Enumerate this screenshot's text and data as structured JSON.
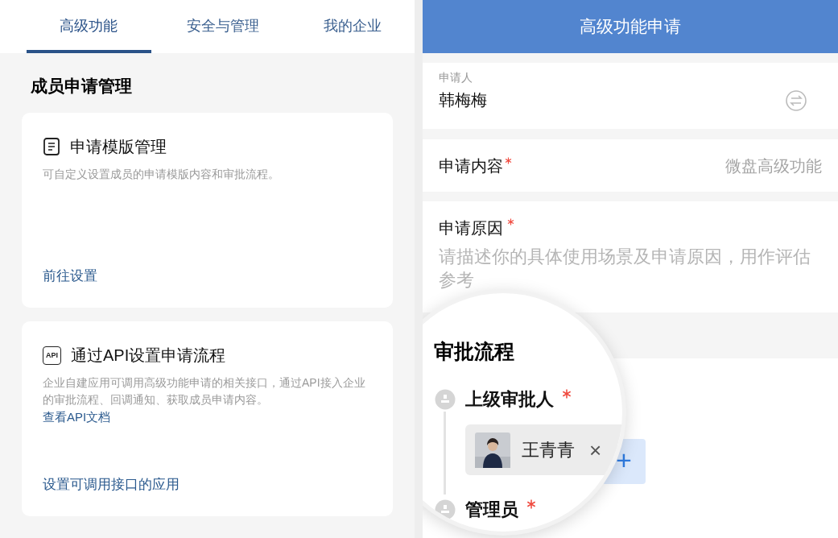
{
  "tabs": [
    {
      "label": "高级功能",
      "selected": true
    },
    {
      "label": "安全与管理",
      "selected": false
    },
    {
      "label": "我的企业",
      "selected": false
    }
  ],
  "section_title": "成员申请管理",
  "cards": [
    {
      "kind": "doc",
      "title": "申请模版管理",
      "description": "可自定义设置成员的申请模版内容和审批流程。",
      "action": "前往设置"
    },
    {
      "kind": "api",
      "icon_text": "API",
      "title": "通过API设置申请流程",
      "description": "企业自建应用可调用高级功能申请的相关接口，通过API接入企业的审批流程、回调通知、获取成员申请内容。",
      "link": "查看API文档",
      "action": "设置可调用接口的应用"
    }
  ],
  "form": {
    "title": "高级功能申请",
    "applicant": {
      "label": "申请人",
      "value": "韩梅梅"
    },
    "content": {
      "label": "申请内容",
      "required": true,
      "value": "微盘高级功能"
    },
    "reason": {
      "label": "申请原因",
      "required": true,
      "placeholder": "请描述你的具体使用场景及申请原因，用作评估参考"
    },
    "approval": {
      "title": "审批流程",
      "add_button": "+",
      "steps": [
        {
          "label": "上级审批人",
          "required": true,
          "approvers": [
            {
              "name": "王青青",
              "remove": "×"
            }
          ]
        },
        {
          "label": "管理员",
          "required": true
        }
      ]
    }
  }
}
